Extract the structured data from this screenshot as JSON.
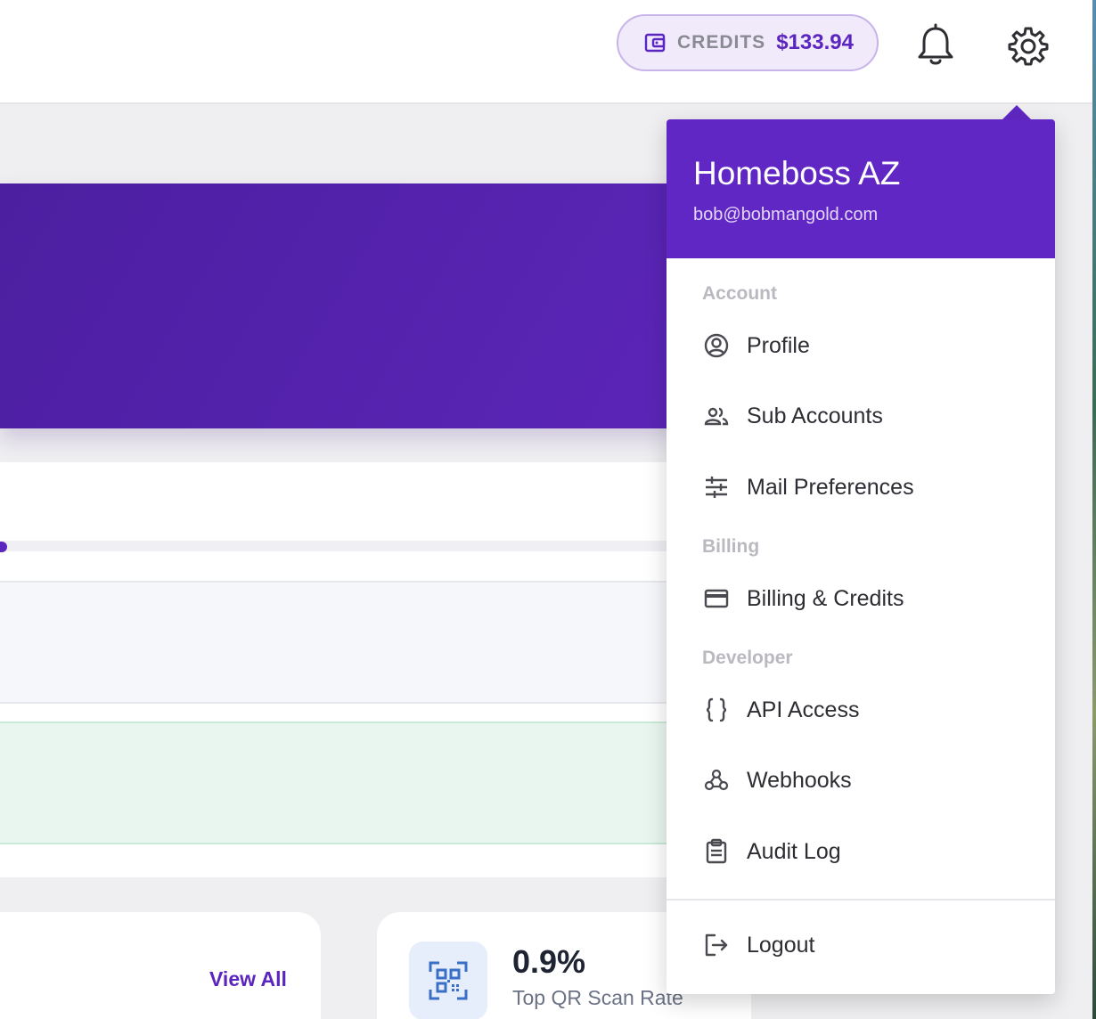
{
  "header": {
    "credits_label": "CREDITS",
    "credits_amount": "$133.94",
    "icons": [
      "wallet-icon",
      "bell-icon",
      "gear-icon"
    ]
  },
  "content": {
    "view_all": "View All",
    "stat_value": "0.9%",
    "stat_label": "Top QR Scan Rate"
  },
  "dropdown": {
    "name": "Homeboss AZ",
    "email": "bob@bobmangold.com",
    "sections": {
      "account": "Account",
      "billing": "Billing",
      "developer": "Developer"
    },
    "items": {
      "profile": "Profile",
      "sub_accounts": "Sub Accounts",
      "mail_preferences": "Mail Preferences",
      "billing_credits": "Billing & Credits",
      "api_access": "API Access",
      "webhooks": "Webhooks",
      "audit_log": "Audit Log",
      "logout": "Logout"
    }
  },
  "colors": {
    "brand": "#6027c4",
    "credits_bg": "#f1eafb",
    "accent_text": "#5b25c0"
  }
}
